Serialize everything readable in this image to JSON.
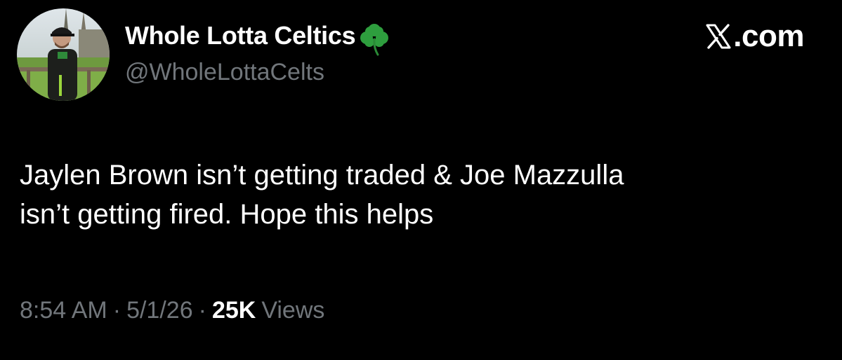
{
  "colors": {
    "background": "#000000",
    "primary_text": "#ffffff",
    "secondary_text": "#71767b",
    "clover": "#2e9e3e"
  },
  "author": {
    "display_name": "Whole Lotta Celtics",
    "name_emoji_icon": "shamrock-icon",
    "handle": "@WholeLottaCelts",
    "avatar_icon": "profile-photo"
  },
  "brand": {
    "logo_icon": "x-logo-icon",
    "text": ".com"
  },
  "tweet": {
    "lines": [
      "Jaylen Brown isn’t getting traded & Joe Mazzulla",
      "isn’t getting fired. Hope this helps"
    ]
  },
  "meta": {
    "time": "8:54 AM",
    "separator": "·",
    "date": "5/1/26",
    "views_count": "25K",
    "views_label": "Views"
  }
}
